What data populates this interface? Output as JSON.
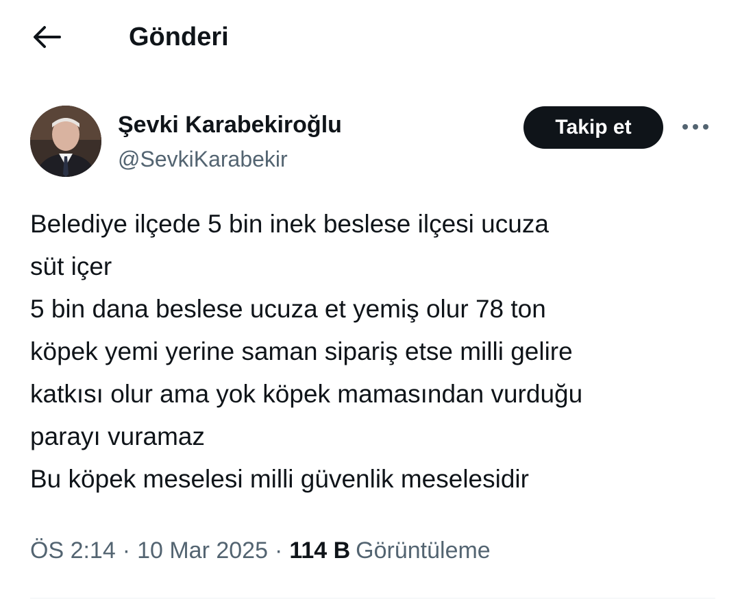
{
  "header": {
    "back_icon": "arrow-left-icon",
    "title": "Gönderi"
  },
  "author": {
    "display_name": "Şevki Karabekiroğlu",
    "handle": "@SevkiKarabekir",
    "follow_label": "Takip et",
    "more_icon": "more-horizontal-icon"
  },
  "tweet": {
    "lines": [
      "Belediye ilçede 5 bin inek beslese  ilçesi ucuza",
      "süt içer",
      "5 bin dana beslese ucuza et yemiş olur 78 ton",
      "köpek yemi yerine saman sipariş etse milli gelire",
      "katkısı olur ama yok köpek mamasından vurduğu",
      "parayı vuramaz",
      "Bu köpek meselesi milli güvenlik meselesidir"
    ]
  },
  "meta": {
    "time": "ÖS 2:14",
    "separator": "·",
    "date": "10 Mar 2025",
    "views_count": "114 B",
    "views_label": "Görüntüleme"
  },
  "colors": {
    "text_primary": "#0f1419",
    "text_secondary": "#536471",
    "follow_button_bg": "#0f1419",
    "divider": "#eff3f4"
  }
}
